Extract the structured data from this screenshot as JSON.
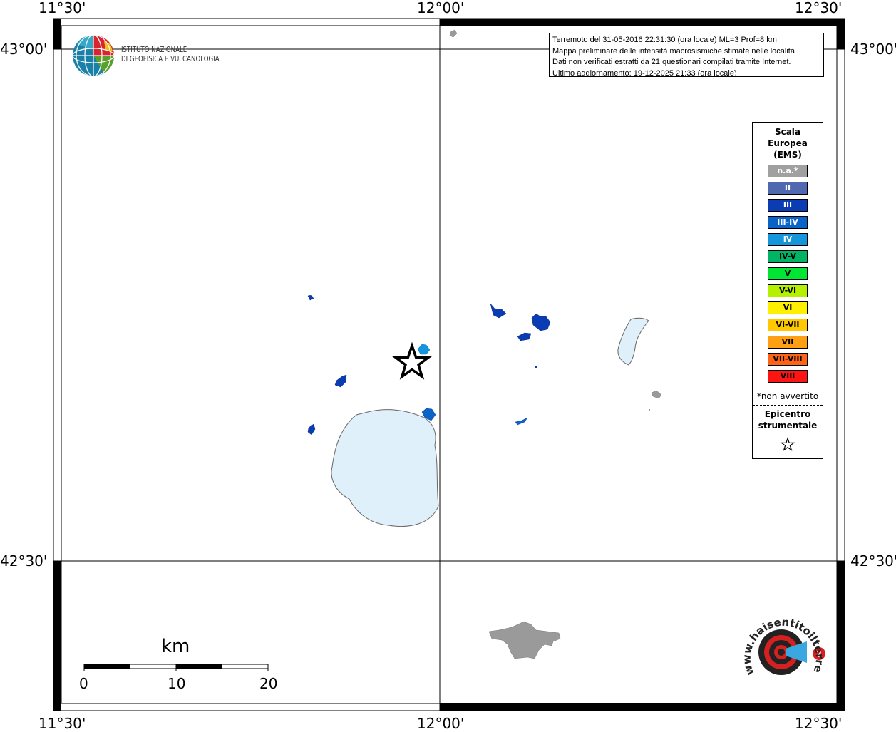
{
  "coords": {
    "top_left": "11°30'",
    "top_mid": "12°00'",
    "top_right": "12°30'",
    "bottom_left": "11°30'",
    "bottom_mid": "12°00'",
    "bottom_right": "12°30'",
    "left_upper": "43°00'",
    "left_lower": "42°30'",
    "right_upper": "43°00'",
    "right_lower": "42°30'"
  },
  "logo": {
    "line1": "ISTITUTO NAZIONALE",
    "line2": "DI GEOFISICA E VULCANOLOGIA"
  },
  "info": {
    "line1": "Terremoto del 31-05-2016 22:31:30 (ora locale) ML=3 Prof=8 km",
    "line2": "Mappa preliminare delle intensità macrosismiche stimate nelle località",
    "line3": "Dati non verificati estratti da 21 questionari compilati tramite Internet.",
    "line4": "Ultimo aggiornamento: 19-12-2025 21:33 (ora locale)"
  },
  "legend": {
    "title1": "Scala",
    "title2": "Europea",
    "title3": "(EMS)",
    "items": [
      {
        "label": "n.a.*",
        "color": "#a0a0a0",
        "text_color": "#ffffff"
      },
      {
        "label": "II",
        "color": "#5068b0",
        "text_color": "#ffffff"
      },
      {
        "label": "III",
        "color": "#0a3cb4",
        "text_color": "#ffffff"
      },
      {
        "label": "III-IV",
        "color": "#0a64c8",
        "text_color": "#ffffff"
      },
      {
        "label": "IV",
        "color": "#1496dc",
        "text_color": "#ffffff"
      },
      {
        "label": "IV-V",
        "color": "#00b464",
        "text_color": "#000000"
      },
      {
        "label": "V",
        "color": "#00e632",
        "text_color": "#000000"
      },
      {
        "label": "V-VI",
        "color": "#b4f000",
        "text_color": "#000000"
      },
      {
        "label": "VI",
        "color": "#fff000",
        "text_color": "#000000"
      },
      {
        "label": "VI-VII",
        "color": "#ffc800",
        "text_color": "#000000"
      },
      {
        "label": "VII",
        "color": "#ffa014",
        "text_color": "#000000"
      },
      {
        "label": "VII-VIII",
        "color": "#ff6414",
        "text_color": "#000000"
      },
      {
        "label": "VIII",
        "color": "#ff1414",
        "text_color": "#000000"
      }
    ],
    "note": "*non avvertito",
    "epicenter1": "Epicentro",
    "epicenter2": "strumentale"
  },
  "scale_bar": {
    "unit": "km",
    "labels": [
      "0",
      "10",
      "20"
    ]
  },
  "hst_logo": {
    "text": "www.haisentitoilterremoto.it"
  },
  "map_colors": {
    "lake": "#dff0fa",
    "grey_locality": "#9a9a9a",
    "intensity_III": "#0a3cb4",
    "intensity_IV": "#1496dc"
  },
  "map_icons": [
    "epicenter-star-icon",
    "ingv-globe-icon",
    "hst-logo-icon"
  ]
}
